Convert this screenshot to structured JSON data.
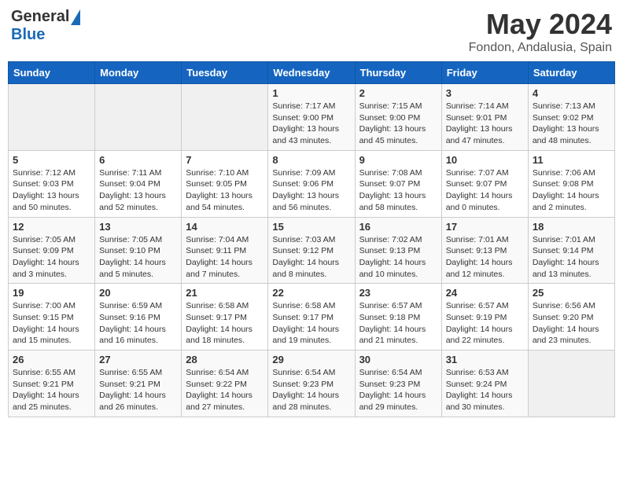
{
  "header": {
    "logo_general": "General",
    "logo_blue": "Blue",
    "title": "May 2024",
    "location": "Fondon, Andalusia, Spain"
  },
  "weekdays": [
    "Sunday",
    "Monday",
    "Tuesday",
    "Wednesday",
    "Thursday",
    "Friday",
    "Saturday"
  ],
  "weeks": [
    [
      {
        "day": "",
        "info": ""
      },
      {
        "day": "",
        "info": ""
      },
      {
        "day": "",
        "info": ""
      },
      {
        "day": "1",
        "info": "Sunrise: 7:17 AM\nSunset: 9:00 PM\nDaylight: 13 hours\nand 43 minutes."
      },
      {
        "day": "2",
        "info": "Sunrise: 7:15 AM\nSunset: 9:00 PM\nDaylight: 13 hours\nand 45 minutes."
      },
      {
        "day": "3",
        "info": "Sunrise: 7:14 AM\nSunset: 9:01 PM\nDaylight: 13 hours\nand 47 minutes."
      },
      {
        "day": "4",
        "info": "Sunrise: 7:13 AM\nSunset: 9:02 PM\nDaylight: 13 hours\nand 48 minutes."
      }
    ],
    [
      {
        "day": "5",
        "info": "Sunrise: 7:12 AM\nSunset: 9:03 PM\nDaylight: 13 hours\nand 50 minutes."
      },
      {
        "day": "6",
        "info": "Sunrise: 7:11 AM\nSunset: 9:04 PM\nDaylight: 13 hours\nand 52 minutes."
      },
      {
        "day": "7",
        "info": "Sunrise: 7:10 AM\nSunset: 9:05 PM\nDaylight: 13 hours\nand 54 minutes."
      },
      {
        "day": "8",
        "info": "Sunrise: 7:09 AM\nSunset: 9:06 PM\nDaylight: 13 hours\nand 56 minutes."
      },
      {
        "day": "9",
        "info": "Sunrise: 7:08 AM\nSunset: 9:07 PM\nDaylight: 13 hours\nand 58 minutes."
      },
      {
        "day": "10",
        "info": "Sunrise: 7:07 AM\nSunset: 9:07 PM\nDaylight: 14 hours\nand 0 minutes."
      },
      {
        "day": "11",
        "info": "Sunrise: 7:06 AM\nSunset: 9:08 PM\nDaylight: 14 hours\nand 2 minutes."
      }
    ],
    [
      {
        "day": "12",
        "info": "Sunrise: 7:05 AM\nSunset: 9:09 PM\nDaylight: 14 hours\nand 3 minutes."
      },
      {
        "day": "13",
        "info": "Sunrise: 7:05 AM\nSunset: 9:10 PM\nDaylight: 14 hours\nand 5 minutes."
      },
      {
        "day": "14",
        "info": "Sunrise: 7:04 AM\nSunset: 9:11 PM\nDaylight: 14 hours\nand 7 minutes."
      },
      {
        "day": "15",
        "info": "Sunrise: 7:03 AM\nSunset: 9:12 PM\nDaylight: 14 hours\nand 8 minutes."
      },
      {
        "day": "16",
        "info": "Sunrise: 7:02 AM\nSunset: 9:13 PM\nDaylight: 14 hours\nand 10 minutes."
      },
      {
        "day": "17",
        "info": "Sunrise: 7:01 AM\nSunset: 9:13 PM\nDaylight: 14 hours\nand 12 minutes."
      },
      {
        "day": "18",
        "info": "Sunrise: 7:01 AM\nSunset: 9:14 PM\nDaylight: 14 hours\nand 13 minutes."
      }
    ],
    [
      {
        "day": "19",
        "info": "Sunrise: 7:00 AM\nSunset: 9:15 PM\nDaylight: 14 hours\nand 15 minutes."
      },
      {
        "day": "20",
        "info": "Sunrise: 6:59 AM\nSunset: 9:16 PM\nDaylight: 14 hours\nand 16 minutes."
      },
      {
        "day": "21",
        "info": "Sunrise: 6:58 AM\nSunset: 9:17 PM\nDaylight: 14 hours\nand 18 minutes."
      },
      {
        "day": "22",
        "info": "Sunrise: 6:58 AM\nSunset: 9:17 PM\nDaylight: 14 hours\nand 19 minutes."
      },
      {
        "day": "23",
        "info": "Sunrise: 6:57 AM\nSunset: 9:18 PM\nDaylight: 14 hours\nand 21 minutes."
      },
      {
        "day": "24",
        "info": "Sunrise: 6:57 AM\nSunset: 9:19 PM\nDaylight: 14 hours\nand 22 minutes."
      },
      {
        "day": "25",
        "info": "Sunrise: 6:56 AM\nSunset: 9:20 PM\nDaylight: 14 hours\nand 23 minutes."
      }
    ],
    [
      {
        "day": "26",
        "info": "Sunrise: 6:55 AM\nSunset: 9:21 PM\nDaylight: 14 hours\nand 25 minutes."
      },
      {
        "day": "27",
        "info": "Sunrise: 6:55 AM\nSunset: 9:21 PM\nDaylight: 14 hours\nand 26 minutes."
      },
      {
        "day": "28",
        "info": "Sunrise: 6:54 AM\nSunset: 9:22 PM\nDaylight: 14 hours\nand 27 minutes."
      },
      {
        "day": "29",
        "info": "Sunrise: 6:54 AM\nSunset: 9:23 PM\nDaylight: 14 hours\nand 28 minutes."
      },
      {
        "day": "30",
        "info": "Sunrise: 6:54 AM\nSunset: 9:23 PM\nDaylight: 14 hours\nand 29 minutes."
      },
      {
        "day": "31",
        "info": "Sunrise: 6:53 AM\nSunset: 9:24 PM\nDaylight: 14 hours\nand 30 minutes."
      },
      {
        "day": "",
        "info": ""
      }
    ]
  ]
}
